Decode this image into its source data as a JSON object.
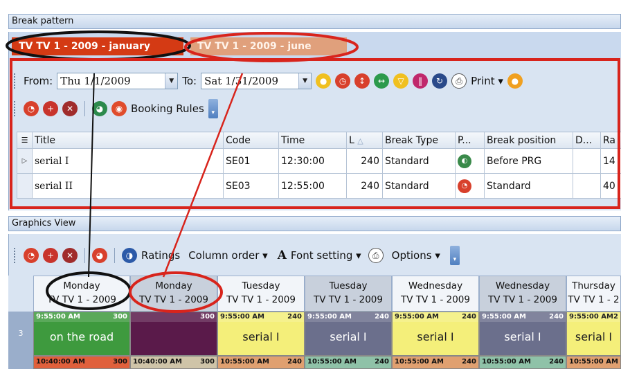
{
  "break_pattern": {
    "caption": "Break pattern"
  },
  "tabs": [
    {
      "label": "TV TV 1 - 2009 - january"
    },
    {
      "label": "TV TV 1 - 2009 - june"
    }
  ],
  "toolbar1": {
    "from_label": "From:",
    "from_value": "Thu 1/1/2009",
    "to_label": "To:",
    "to_value": "Sat 1/31/2009",
    "print_label": "Print"
  },
  "toolbar2": {
    "booking_rules_label": "Booking Rules"
  },
  "table": {
    "columns": [
      "Title",
      "Code",
      "Time",
      "L",
      "Break Type",
      "P...",
      "Break position",
      "D...",
      "Ra"
    ],
    "rows": [
      {
        "title": "serial I",
        "code": "SE01",
        "time": "12:30:00",
        "length": "240",
        "break_type": "Standard",
        "break_position": "Before PRG",
        "rating": "14"
      },
      {
        "title": "serial II",
        "code": "SE03",
        "time": "12:55:00",
        "length": "240",
        "break_type": "Standard",
        "break_position": "Standard",
        "rating": "40"
      }
    ]
  },
  "graphics_view": {
    "caption": "Graphics View",
    "ratings_label": "Ratings",
    "column_order_label": "Column order",
    "font_setting_label": "Font setting",
    "options_label": "Options"
  },
  "days": [
    {
      "day": "Monday",
      "channel": "TV TV 1 - 2009"
    },
    {
      "day": "Monday",
      "channel": "TV TV 1 - 2009"
    },
    {
      "day": "Tuesday",
      "channel": "TV TV 1 - 2009"
    },
    {
      "day": "Tuesday",
      "channel": "TV TV 1 - 2009"
    },
    {
      "day": "Wednesday",
      "channel": "TV TV 1 - 2009"
    },
    {
      "day": "Wednesday",
      "channel": "TV TV 1 - 2009"
    },
    {
      "day": "Thursday",
      "channel": "TV TV 1 - 2"
    }
  ],
  "row_label": "3",
  "cells_row1": [
    {
      "time": "9:55:00 AM",
      "len": "300",
      "title": "on the road",
      "color": "#3e9a3e"
    },
    {
      "time": "",
      "len": "300",
      "title": "",
      "color": "#5a1a4a"
    },
    {
      "time": "9:55:00 AM",
      "len": "240",
      "title": "serial I",
      "color": "#f4ef7a"
    },
    {
      "time": "9:55:00 AM",
      "len": "240",
      "title": "serial I",
      "color": "#6b6f8c"
    },
    {
      "time": "9:55:00 AM",
      "len": "240",
      "title": "serial I",
      "color": "#f4ef7a"
    },
    {
      "time": "9:55:00 AM",
      "len": "240",
      "title": "serial I",
      "color": "#6b6f8c"
    },
    {
      "time": "9:55:00 AM",
      "len": "2",
      "title": "serial I",
      "color": "#f4ef7a"
    }
  ],
  "cells_row2": [
    {
      "time": "10:40:00 AM",
      "len": "300",
      "color": "#e0603c"
    },
    {
      "time": "10:40:00 AM",
      "len": "300",
      "color": "#cfc4a8"
    },
    {
      "time": "10:55:00 AM",
      "len": "240",
      "color": "#e0a070"
    },
    {
      "time": "10:55:00 AM",
      "len": "240",
      "color": "#8fc2a8"
    },
    {
      "time": "10:55:00 AM",
      "len": "240",
      "color": "#e0a070"
    },
    {
      "time": "10:55:00 AM",
      "len": "240",
      "color": "#8fc2a8"
    },
    {
      "time": "10:55:00 AM",
      "len": "",
      "color": "#e0a070"
    }
  ],
  "colors": {
    "annotation_red": "#d8241c",
    "annotation_black": "#111111",
    "tab_active": "#d43a14",
    "tab_inactive": "#e0a07c"
  }
}
